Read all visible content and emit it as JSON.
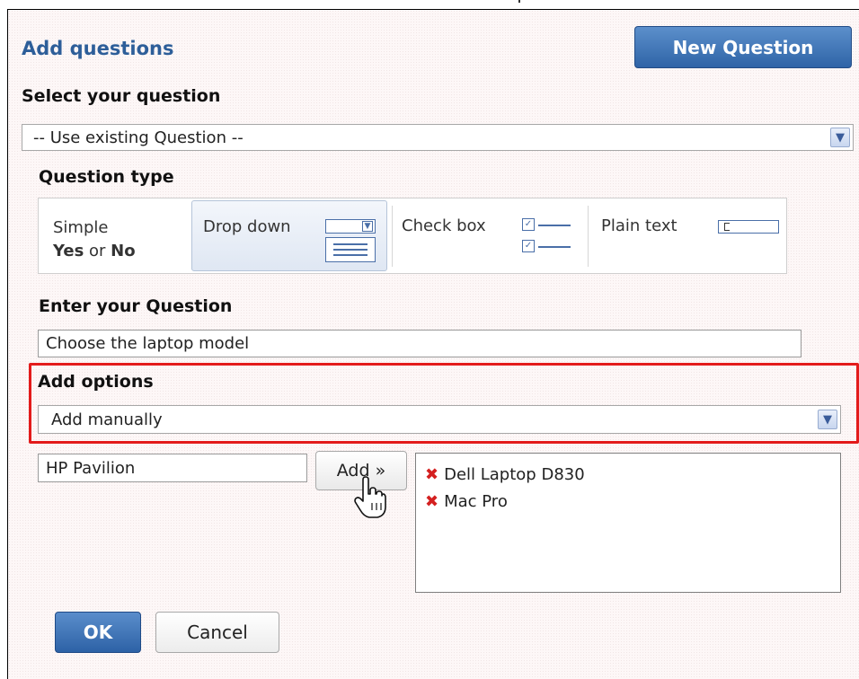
{
  "dialog": {
    "title": "Add questions",
    "new_question_label": "New Question"
  },
  "select_question": {
    "label": "Select your question",
    "value": "-- Use existing Question --"
  },
  "question_type": {
    "label": "Question type",
    "options": {
      "simple_line1": "Simple",
      "simple_yes": "Yes",
      "simple_or": " or ",
      "simple_no": "No",
      "dropdown": "Drop down",
      "checkbox": "Check box",
      "plaintext": "Plain text"
    },
    "selected": "Drop down"
  },
  "enter_question": {
    "label": "Enter your Question",
    "value": "Choose the laptop model"
  },
  "add_options": {
    "label": "Add options",
    "value": "Add manually"
  },
  "option_entry": {
    "value": "HP Pavilion",
    "add_label": "Add »"
  },
  "options_list": [
    "Dell Laptop D830",
    "Mac Pro"
  ],
  "footer": {
    "ok_label": "OK",
    "cancel_label": "Cancel"
  },
  "icons": {
    "dropdown_arrow": "chevron-down-icon",
    "remove": "x-icon",
    "cursor": "hand-pointer-icon"
  }
}
